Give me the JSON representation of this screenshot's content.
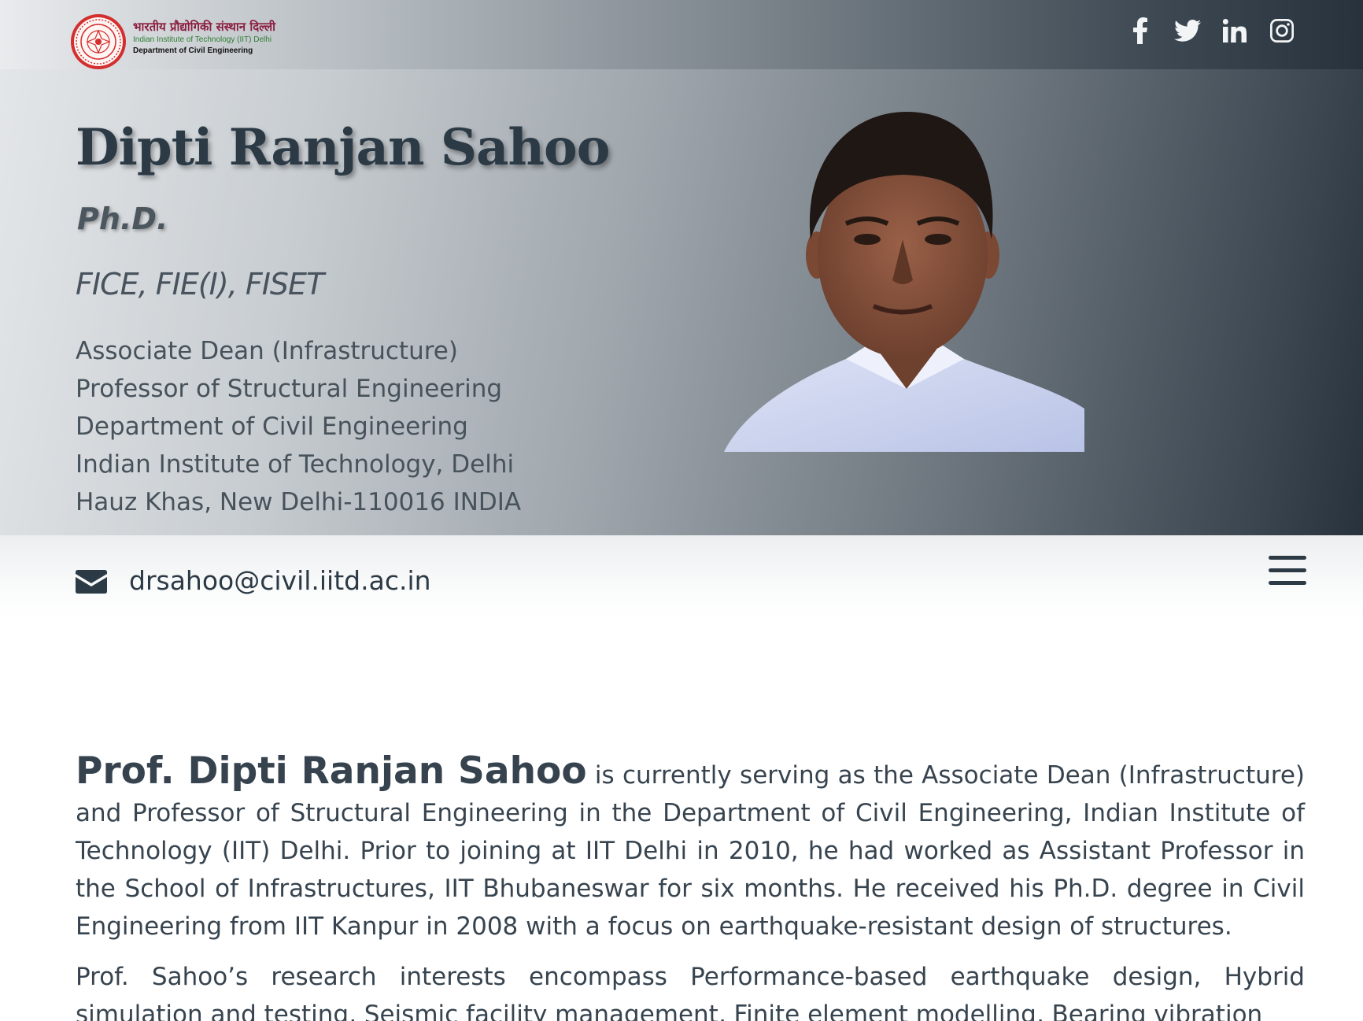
{
  "header": {
    "logo": {
      "line1": "भारतीय प्रौद्योगिकी संस्थान दिल्ली",
      "line2": "Indian Institute of Technology (IIT) Delhi",
      "line3": "Department of Civil Engineering"
    },
    "social": [
      "facebook-icon",
      "twitter-icon",
      "linkedin-icon",
      "instagram-icon"
    ]
  },
  "profile": {
    "name": "Dipti Ranjan Sahoo",
    "degree": "Ph.D.",
    "fellowships": "FICE, FIE(I), FISET",
    "address_lines": [
      "Associate Dean (Infrastructure)",
      "Professor of Structural Engineering",
      "Department of Civil Engineering",
      "Indian Institute of Technology, Delhi",
      "Hauz Khas, New Delhi-110016 INDIA"
    ]
  },
  "contact": {
    "email": "drsahoo@civil.iitd.ac.in"
  },
  "bio": {
    "lead": "Prof. Dipti Ranjan Sahoo",
    "para1_rest": " is currently serving as the Associate Dean (Infrastructure) and Professor of Structural Engineering in the Department of Civil Engineering, Indian Institute of Technology (IIT) Delhi. Prior to joining at IIT Delhi in 2010, he had worked as Assistant Professor in the School of Infrastructures, IIT Bhubaneswar for six months. He received his Ph.D. degree in Civil Engineering from IIT Kanpur in 2008 with a focus on earthquake-resistant design of structures.",
    "para2": "Prof. Sahoo’s research interests encompass Performance-based earthquake design, Hybrid simulation and testing, Seismic facility management, Finite element modelling, Bearing vibration"
  },
  "colors": {
    "header_dark": "#27323c",
    "text_dark": "#2c3a46",
    "logo_red": "#d32f2f"
  }
}
